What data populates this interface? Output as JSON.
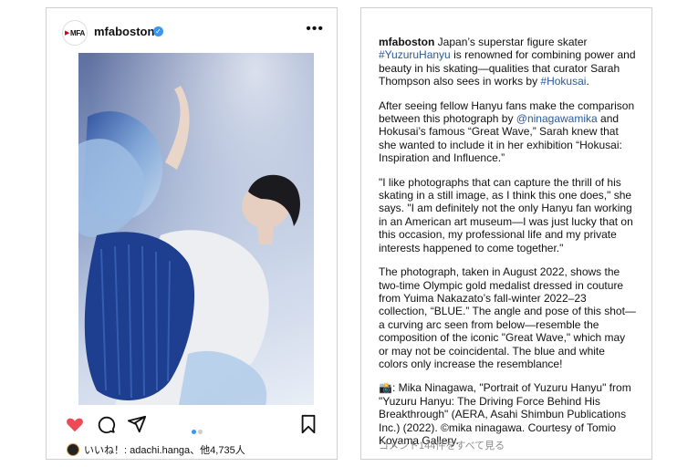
{
  "post": {
    "username": "mfaboston",
    "logo_text": "MFA",
    "verified": true,
    "more_label": "•••",
    "likes_text": "いいね！: adachi.hanga、他4,735人",
    "carousel": {
      "count": 2,
      "active": 0
    }
  },
  "caption": {
    "username": "mfaboston",
    "p1_a": " Japan’s superstar figure skater ",
    "p1_tag1": "#YuzuruHanyu",
    "p1_b": " is renowned for combining power and beauty in his skating—qualities that curator Sarah Thompson also sees in works by ",
    "p1_tag2": "#Hokusai",
    "p1_c": ".",
    "p2_a": "After seeing fellow Hanyu fans make the comparison between this photograph by ",
    "p2_tag": "@ninagawamika",
    "p2_b": " and Hokusai’s famous “Great Wave,” Sarah knew that she wanted to include it in her exhibition “Hokusai: Inspiration and Influence.”",
    "p3": "\"I like photographs that can capture the thrill of his skating in a still image, as I think this one does,\" she says. \"I am definitely not the only Hanyu fan working in an American art museum—I was just lucky that on this occasion, my professional life and my private interests happened to come together.\"",
    "p4": "The photograph, taken in August 2022, shows the two-time Olympic gold medalist dressed in couture from Yuima Nakazato’s fall-winter 2022–23 collection, “BLUE.” The angle and pose of this shot—a curving arc seen from below—resemble the composition of the iconic \"Great Wave,\" which may or may not be coincidental. The blue and white colors only increase the resemblance!",
    "p5": "📸: Mika Ninagawa, \"Portrait of Yuzuru Hanyu\" from \"Yuzuru Hanyu: The Driving Force Behind His Breakthrough\" (AERA, Asahi Shimbun Publications Inc.) (2022). ©mika ninagawa. Courtesy of Tomio Koyama Gallery.",
    "view_comments": "コメント144件をすべて見る"
  },
  "icons": {
    "heart": "heart-icon",
    "comment": "comment-icon",
    "share": "share-icon",
    "save": "bookmark-icon",
    "user_tag": "user-tag-icon",
    "more": "more-icon",
    "verified": "verified-badge-icon"
  },
  "colors": {
    "heart": "#ed4956",
    "link": "#2b5a9a",
    "verified": "#3897f0",
    "muted": "#8e8e8e"
  }
}
